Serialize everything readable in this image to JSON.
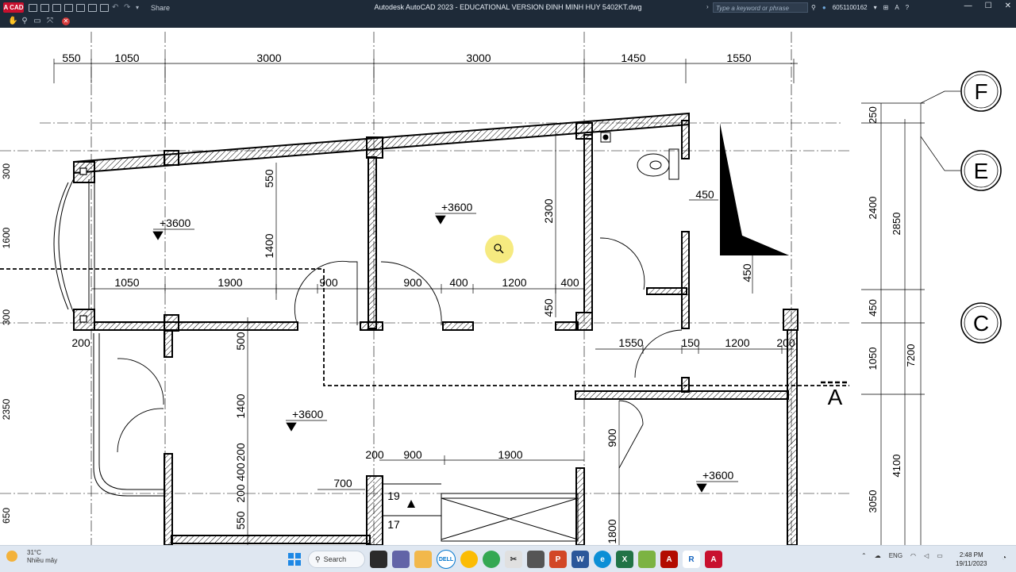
{
  "titlebar": {
    "logo": "A CAD",
    "share_label": "Share",
    "title": "Autodesk AutoCAD 2023 - EDUCATIONAL VERSION    ĐINH MINH HUY 5402KT.dwg",
    "search_placeholder": "Type a keyword or phrase",
    "user": "6051100162",
    "help": "?",
    "window_controls": [
      "—",
      "☐",
      "✕"
    ]
  },
  "navbar": {
    "tools": [
      "pan-icon",
      "zoom-icon",
      "zoom-window-icon",
      "zoom-extents-icon",
      "close-icon"
    ]
  },
  "drawing": {
    "dims_top": [
      "550",
      "1050",
      "3000",
      "3000",
      "1450",
      "1550"
    ],
    "dims_mid": [
      "1050",
      "1900",
      "900",
      "900",
      "400",
      "1200",
      "400"
    ],
    "dims_vertical": [
      "550",
      "1400",
      "2300",
      "450",
      "450",
      "500",
      "1400",
      "200",
      "400",
      "200",
      "550",
      "900",
      "1800"
    ],
    "dims_lower": [
      "200",
      "1550",
      "150",
      "1200",
      "200",
      "200",
      "900",
      "1900",
      "700"
    ],
    "dims_right": [
      "250",
      "2400",
      "2850",
      "450",
      "1050",
      "7200",
      "4100",
      "3050"
    ],
    "grid_labels": [
      "F",
      "E",
      "C"
    ],
    "section_label": "A",
    "levels": [
      "+3600",
      "+3600",
      "+3600",
      "+3600"
    ],
    "stair_numbers": [
      "19",
      "17"
    ],
    "partial_left": [
      "300",
      "1600",
      "300",
      "2350",
      "650"
    ],
    "misc_450": "450"
  },
  "taskbar": {
    "temperature": "31°C",
    "weather_text": "Nhiều mây",
    "search_label": "Search",
    "apps": [
      "start-icon",
      "search",
      "task-view-icon",
      "chat-icon",
      "file-explorer-icon",
      "dell-icon",
      "chrome-icon",
      "chrome-icon",
      "snip-icon",
      "phone-icon",
      "powerpoint-icon",
      "word-icon",
      "edge-icon",
      "excel-icon",
      "plant-icon",
      "pdf-icon",
      "revit-icon",
      "autocad-icon"
    ],
    "lang": "ENG",
    "time": "2:48 PM",
    "date": "19/11/2023"
  },
  "colors": {
    "titlebar_bg": "#1e2a38",
    "canvas_bg": "#ffffff",
    "accent": "#c8102e"
  }
}
